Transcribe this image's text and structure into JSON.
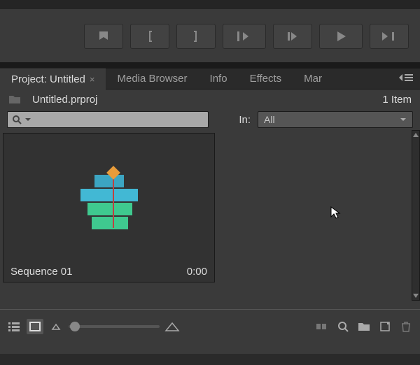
{
  "tabs": {
    "project": "Project: Untitled",
    "media_browser": "Media Browser",
    "info": "Info",
    "effects": "Effects",
    "markers": "Mar"
  },
  "project": {
    "filename": "Untitled.prproj",
    "item_count_label": "1 Item"
  },
  "search": {
    "placeholder": ""
  },
  "filter": {
    "in_label": "In:",
    "selected": "All"
  },
  "thumbnail": {
    "name": "Sequence 01",
    "duration": "0:00"
  }
}
